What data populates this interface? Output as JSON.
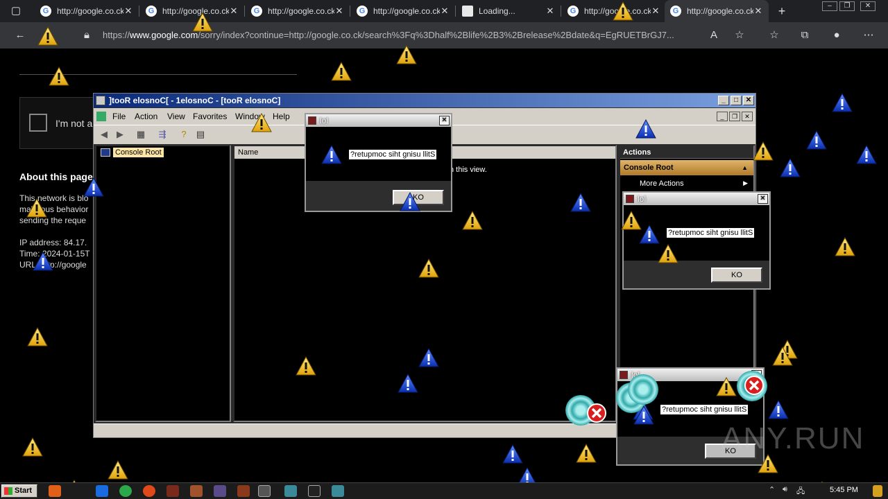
{
  "browser": {
    "tabs": [
      {
        "title": "http://google.co.ck",
        "favicon": "google-icon"
      },
      {
        "title": "http://google.co.ck",
        "favicon": "google-icon"
      },
      {
        "title": "http://google.co.ck",
        "favicon": "google-icon"
      },
      {
        "title": "http://google.co.ck",
        "favicon": "google-icon"
      },
      {
        "title": "Loading...",
        "favicon": "blank-page-icon"
      },
      {
        "title": "http://google.co.ck",
        "favicon": "google-icon"
      },
      {
        "title": "http://google.co.ck",
        "favicon": "google-icon"
      }
    ],
    "url_prefix": "https://",
    "url_host": "www.google.com",
    "url_rest": "/sorry/index?continue=http://google.co.ck/search%3Fq%3Dhalf%2Blife%2B3%2Brelease%2Bdate&q=EgRUETBrGJ7..."
  },
  "page": {
    "captcha_label": "I'm not a",
    "about_title": "About this page",
    "lines": [
      "This network is blo",
      "malicious behavior",
      "sending the reque",
      "",
      "IP address: 84.17.",
      "Time: 2024-01-15T",
      "URL: http://google"
    ]
  },
  "mmc": {
    "title": "]tooR elosnoC[ - 1elosnoC - [tooR elosnoC]",
    "menu": [
      "File",
      "Action",
      "View",
      "Favorites",
      "Window",
      "Help"
    ],
    "tree_root": "Console Root",
    "column_name": "Name",
    "empty_message": "n this view.",
    "actions_header": "Actions",
    "actions_root": "Console Root",
    "more_actions": "More Actions"
  },
  "dialogs": [
    {
      "title": "lol",
      "message": "?retupmoc siht gnisu llitS",
      "button": "KO"
    },
    {
      "title": "lol",
      "message": "?retupmoc siht gnisu llitS",
      "button": "KO"
    },
    {
      "title": "lol",
      "message": "?retupmoc siht gnisu llitS",
      "button": "KO"
    }
  ],
  "watermark": "ANY.RUN",
  "taskbar": {
    "start_label": "Start",
    "clock": "5:45 PM"
  },
  "colors": {
    "warning": "#f2c21b",
    "info": "#1a4fd6",
    "error": "#d81e1e",
    "title_bar_start": "#0a2a7a",
    "title_bar_end": "#7aa0e0"
  }
}
